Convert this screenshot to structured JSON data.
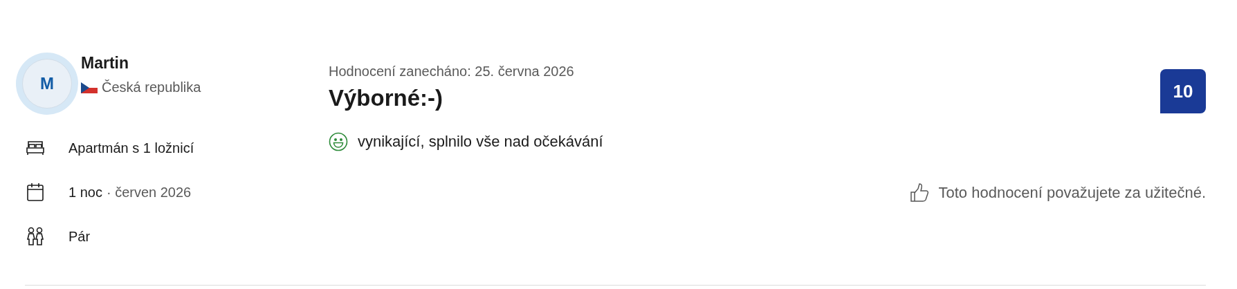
{
  "reviewer": {
    "initial": "M",
    "name": "Martin",
    "country": "Česká republika"
  },
  "stay": [
    {
      "kind": "room",
      "text": "Apartmán s 1 ložnicí"
    },
    {
      "kind": "date",
      "text": "1 noc",
      "detail": "· červen 2026"
    },
    {
      "kind": "group",
      "text": "Pár"
    }
  ],
  "review": {
    "date": "Hodnocení zanecháno: 25. června 2026",
    "title": "Výborné:-)",
    "lines": [
      {
        "kind": "positive",
        "text": "vynikající, splnilo vše nad očekávání"
      }
    ]
  },
  "score": "10",
  "helpful": "Toto hodnocení považujete za užitečné."
}
